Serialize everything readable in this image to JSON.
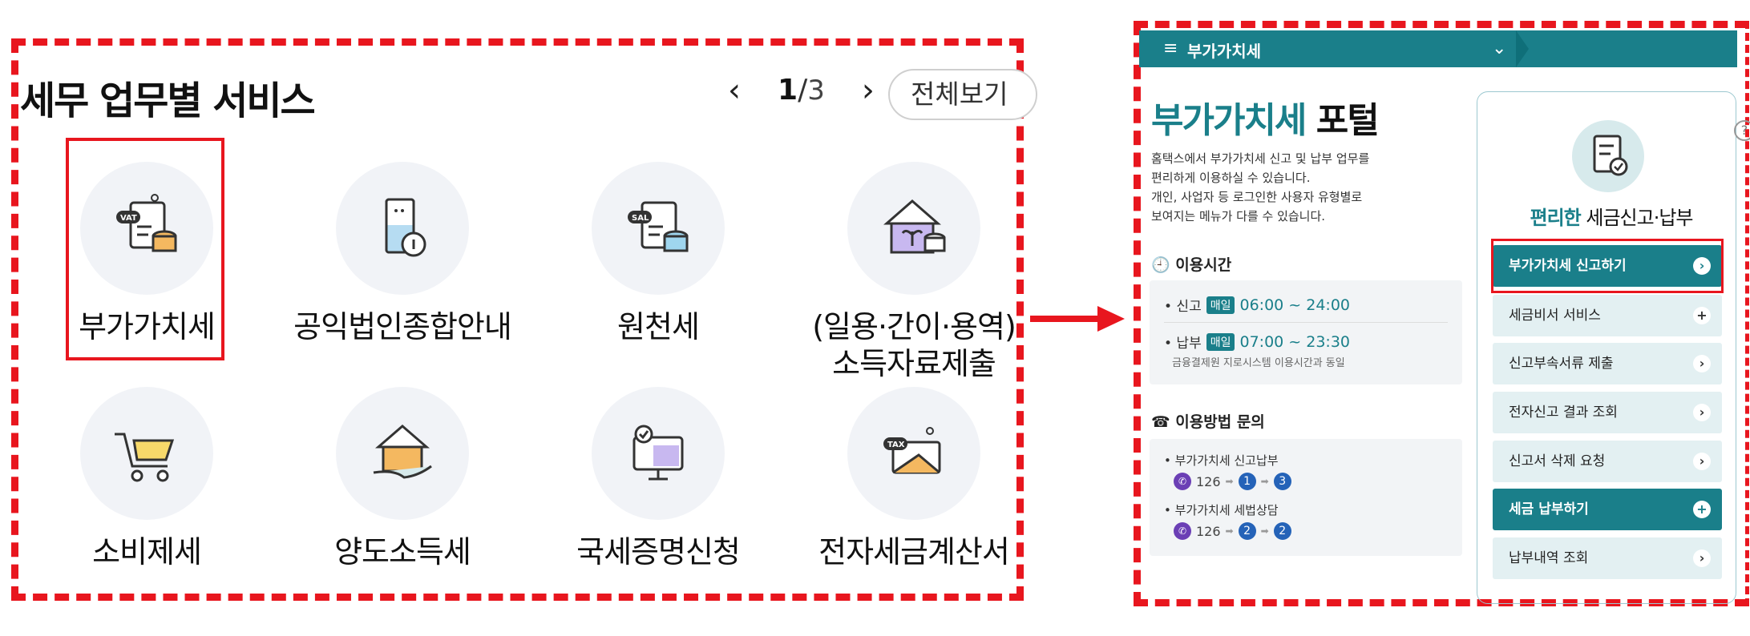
{
  "left": {
    "section_title": "세무 업무별 서비스",
    "pager": {
      "prev": "‹",
      "current": "1",
      "sep": "/",
      "total": "3",
      "next": "›"
    },
    "view_all": "전체보기",
    "tiles": [
      {
        "label": "부가가치세",
        "icon": "vat-document-coins-icon"
      },
      {
        "label": "공익법인종합안내",
        "icon": "building-info-icon"
      },
      {
        "label": "원천세",
        "icon": "sal-document-coins-icon"
      },
      {
        "label": "(일용·간이·용역)",
        "label2": "소득자료제출",
        "icon": "house-plant-coins-icon"
      },
      {
        "label": "소비제세",
        "icon": "shopping-cart-icon"
      },
      {
        "label": "양도소득세",
        "icon": "house-hand-icon"
      },
      {
        "label": "국세증명신청",
        "icon": "certificate-monitor-icon"
      },
      {
        "label": "전자세금계산서",
        "icon": "tax-envelope-icon"
      }
    ]
  },
  "right": {
    "topbar": {
      "menu": "≡",
      "title": "부가가치세",
      "chevron": "⌄"
    },
    "portal_title_hl": "부가가치세",
    "portal_title_rest": " 포털",
    "desc": [
      "홈택스에서 부가가치세 신고 및 납부 업무를",
      "편리하게 이용하실 수 있습니다.",
      "개인, 사업자 등 로그인한 사용자 유형별로",
      "보여지는 메뉴가 다를 수 있습니다."
    ],
    "hours_title": "이용시간",
    "hours": [
      {
        "label": "• 신고",
        "badge": "매일",
        "time": "06:00 ~ 24:00"
      },
      {
        "label": "• 납부",
        "badge": "매일",
        "time": "07:00 ~ 23:30",
        "note": "금융결제원 지로시스템 이용시간과 동일"
      }
    ],
    "contact_title": "이용방법 문의",
    "contacts": [
      {
        "label": "• 부가가치세 신고납부",
        "number": "126",
        "steps": [
          "1",
          "3"
        ]
      },
      {
        "label": "• 부가가치세 세법상담",
        "number": "126",
        "steps": [
          "2",
          "2"
        ]
      }
    ],
    "panel": {
      "help": "?",
      "title_hl": "편리한",
      "title_rest": " 세금신고·납부",
      "buttons": [
        {
          "label": "부가가치세 신고하기",
          "icon": "›",
          "style": "dark"
        },
        {
          "label": "세금비서 서비스",
          "icon": "+",
          "style": "light"
        },
        {
          "label": "신고부속서류 제출",
          "icon": "›",
          "style": "light"
        },
        {
          "label": "전자신고 결과 조회",
          "icon": "›",
          "style": "light"
        },
        {
          "label": "신고서 삭제 요청",
          "icon": "›",
          "style": "light"
        },
        {
          "label": "세금 납부하기",
          "icon": "+",
          "style": "dark"
        },
        {
          "label": "납부내역 조회",
          "icon": "›",
          "style": "light"
        }
      ]
    }
  },
  "colors": {
    "accent": "#1a7f8a",
    "annotation": "#e8161e",
    "tile_bg": "#f1f3f7"
  }
}
